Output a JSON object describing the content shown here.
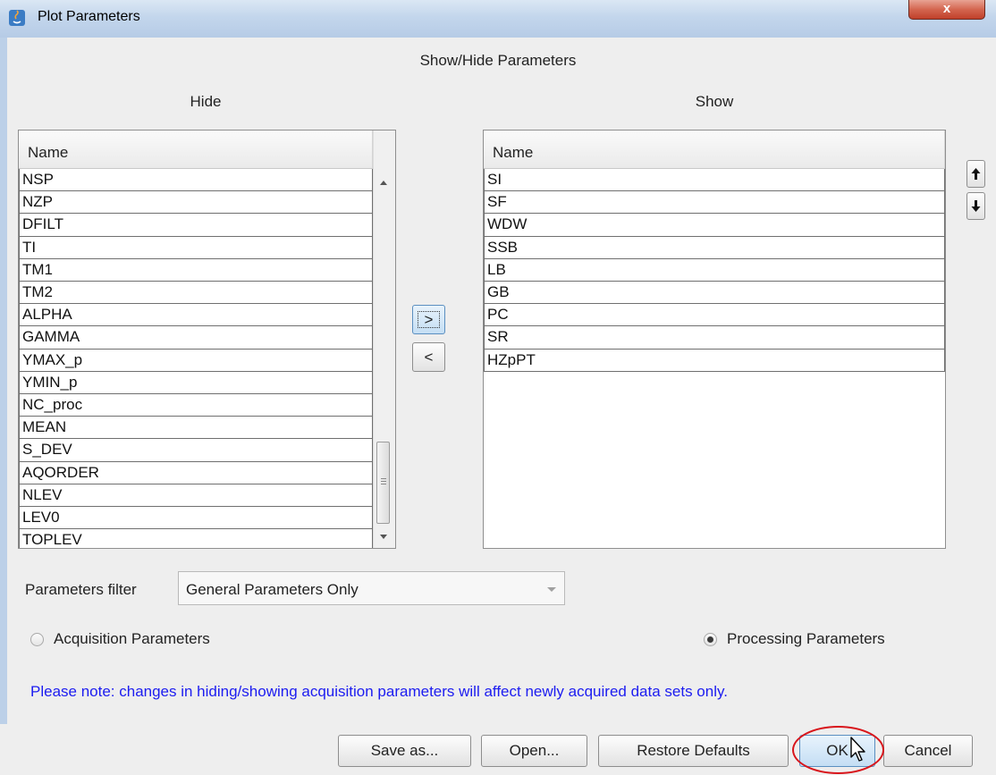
{
  "window": {
    "title": "Plot Parameters",
    "close_glyph": "x",
    "app_icon": "java-app-icon"
  },
  "section_title": "Show/Hide Parameters",
  "hide": {
    "label": "Hide",
    "column_header": "Name",
    "items": [
      "NSP",
      "NZP",
      "DFILT",
      "TI",
      "TM1",
      "TM2",
      "ALPHA",
      "GAMMA",
      "YMAX_p",
      "YMIN_p",
      "NC_proc",
      "MEAN",
      "S_DEV",
      "AQORDER",
      "NLEV",
      "LEV0",
      "TOPLEV"
    ]
  },
  "show": {
    "label": "Show",
    "column_header": "Name",
    "items": [
      "SI",
      "SF",
      "WDW",
      "SSB",
      "LB",
      "GB",
      "PC",
      "SR",
      "HZpPT"
    ]
  },
  "move_right_label": ">",
  "move_left_label": "<",
  "order_buttons": {
    "up_icon": "arrow-up-icon",
    "down_icon": "arrow-down-icon"
  },
  "filter": {
    "label": "Parameters filter",
    "selected": "General Parameters Only"
  },
  "radios": {
    "acquisition": {
      "label": "Acquisition Parameters",
      "selected": false
    },
    "processing": {
      "label": "Processing Parameters",
      "selected": true
    }
  },
  "note": "Please note: changes in hiding/showing acquisition parameters will affect newly acquired data sets only.",
  "buttons": {
    "save_as": "Save as...",
    "open": "Open...",
    "restore": "Restore Defaults",
    "ok": "OK",
    "cancel": "Cancel"
  },
  "colors": {
    "note_text": "#1c1cf0",
    "highlight_circle": "#d8151b",
    "titlebar": "#c3d6ec"
  }
}
